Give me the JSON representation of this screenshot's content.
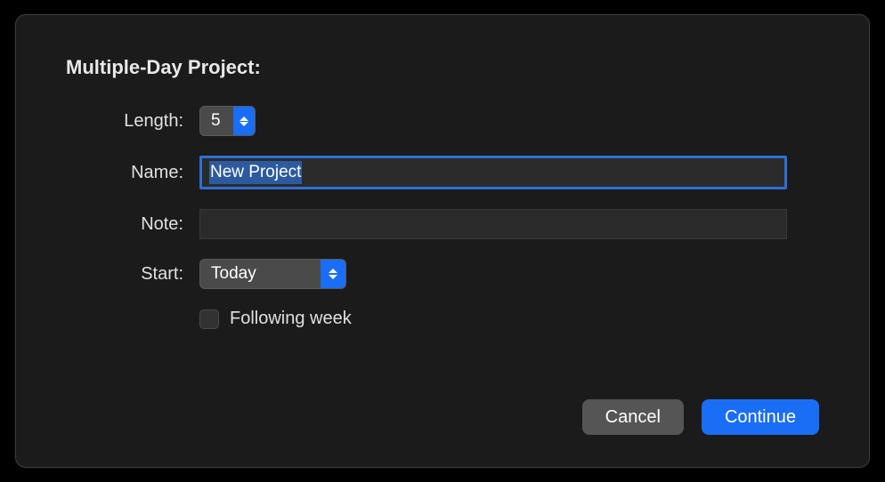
{
  "dialog": {
    "title": "Multiple-Day Project:",
    "fields": {
      "length": {
        "label": "Length:",
        "value": "5"
      },
      "name": {
        "label": "Name:",
        "value": "New Project"
      },
      "note": {
        "label": "Note:",
        "value": ""
      },
      "start": {
        "label": "Start:",
        "value": "Today"
      },
      "following_week": {
        "label": "Following week",
        "checked": false
      }
    },
    "buttons": {
      "cancel": "Cancel",
      "continue": "Continue"
    }
  }
}
